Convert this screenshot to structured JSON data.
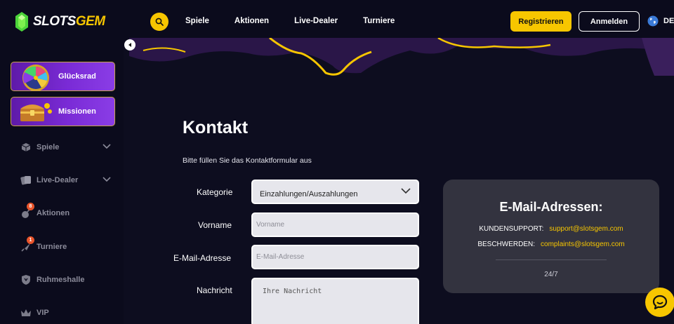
{
  "header": {
    "logo_part1": "SLOTS",
    "logo_part2": "GEM",
    "nav": [
      "Spiele",
      "Aktionen",
      "Live-Dealer",
      "Turniere"
    ],
    "register_label": "Registrieren",
    "login_label": "Anmelden",
    "language": "DE"
  },
  "sidebar": {
    "promos": [
      {
        "label": "Glücksrad",
        "icon": "wheel-of-fortune-icon"
      },
      {
        "label": "Missionen",
        "icon": "treasure-chest-icon"
      }
    ],
    "items": [
      {
        "label": "Spiele",
        "icon": "cube-icon",
        "expandable": true
      },
      {
        "label": "Live-Dealer",
        "icon": "cards-icon",
        "expandable": true
      },
      {
        "label": "Aktionen",
        "icon": "bomb-icon",
        "badge": "8"
      },
      {
        "label": "Turniere",
        "icon": "rocket-icon",
        "badge": "1"
      },
      {
        "label": "Ruhmeshalle",
        "icon": "shield-icon"
      },
      {
        "label": "VIP",
        "icon": "crown-icon"
      }
    ]
  },
  "contact": {
    "title": "Kontakt",
    "subtitle": "Bitte füllen Sie das Kontaktformular aus",
    "fields": {
      "category_label": "Kategorie",
      "category_value": "Einzahlungen/Auszahlungen",
      "firstname_label": "Vorname",
      "firstname_placeholder": "Vorname",
      "email_label": "E-Mail-Adresse",
      "email_placeholder": "E-Mail-Adresse",
      "message_label": "Nachricht",
      "message_placeholder": "Ihre Nachricht"
    }
  },
  "email_card": {
    "title": "E-Mail-Adressen:",
    "support_key": "KUNDENSUPPORT:",
    "support_value": "support@slotsgem.com",
    "complaints_key": "BESCHWERDEN:",
    "complaints_value": "complaints@slotsgem.com",
    "hours": "24/7"
  },
  "colors": {
    "accent": "#f7c600",
    "background": "#0d0d1f",
    "card": "#33333f",
    "promo_purple": "#7a2bd6"
  }
}
